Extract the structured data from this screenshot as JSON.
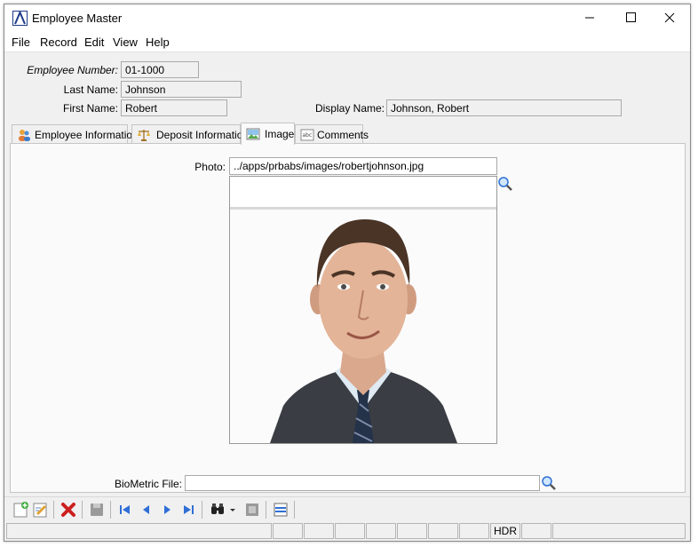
{
  "window": {
    "title": "Employee Master"
  },
  "menu": [
    "File",
    "Record",
    "Edit",
    "View",
    "Help"
  ],
  "header": {
    "employee_number_label": "Employee Number:",
    "employee_number": "01-1000",
    "last_name_label": "Last Name:",
    "last_name": "Johnson",
    "first_name_label": "First Name:",
    "first_name": "Robert",
    "display_name_label": "Display Name:",
    "display_name": "Johnson, Robert"
  },
  "tabs": [
    {
      "label": "Employee Information",
      "icon": "people-icon"
    },
    {
      "label": "Deposit Information",
      "icon": "scales-icon"
    },
    {
      "label": "Image",
      "icon": "picture-icon",
      "active": true
    },
    {
      "label": "Comments",
      "icon": "abc-icon"
    }
  ],
  "image_tab": {
    "photo_label": "Photo:",
    "photo_path": "../apps/prbabs/images/robertjohnson.jpg",
    "biometric_label": "BioMetric File:",
    "biometric_value": ""
  },
  "toolbar": {
    "icons": [
      "new-record-icon",
      "edit-record-icon",
      "delete-icon",
      "save-icon",
      "first-record-icon",
      "previous-record-icon",
      "next-record-icon",
      "last-record-icon",
      "find-icon",
      "find-dropdown-icon",
      "view-icon",
      "list-view-icon"
    ]
  },
  "status": {
    "hdr": "HDR"
  },
  "colors": {
    "accent": "#1f3a8a",
    "nav_blue": "#2f6fd6",
    "delete_red": "#cc1f1f"
  }
}
